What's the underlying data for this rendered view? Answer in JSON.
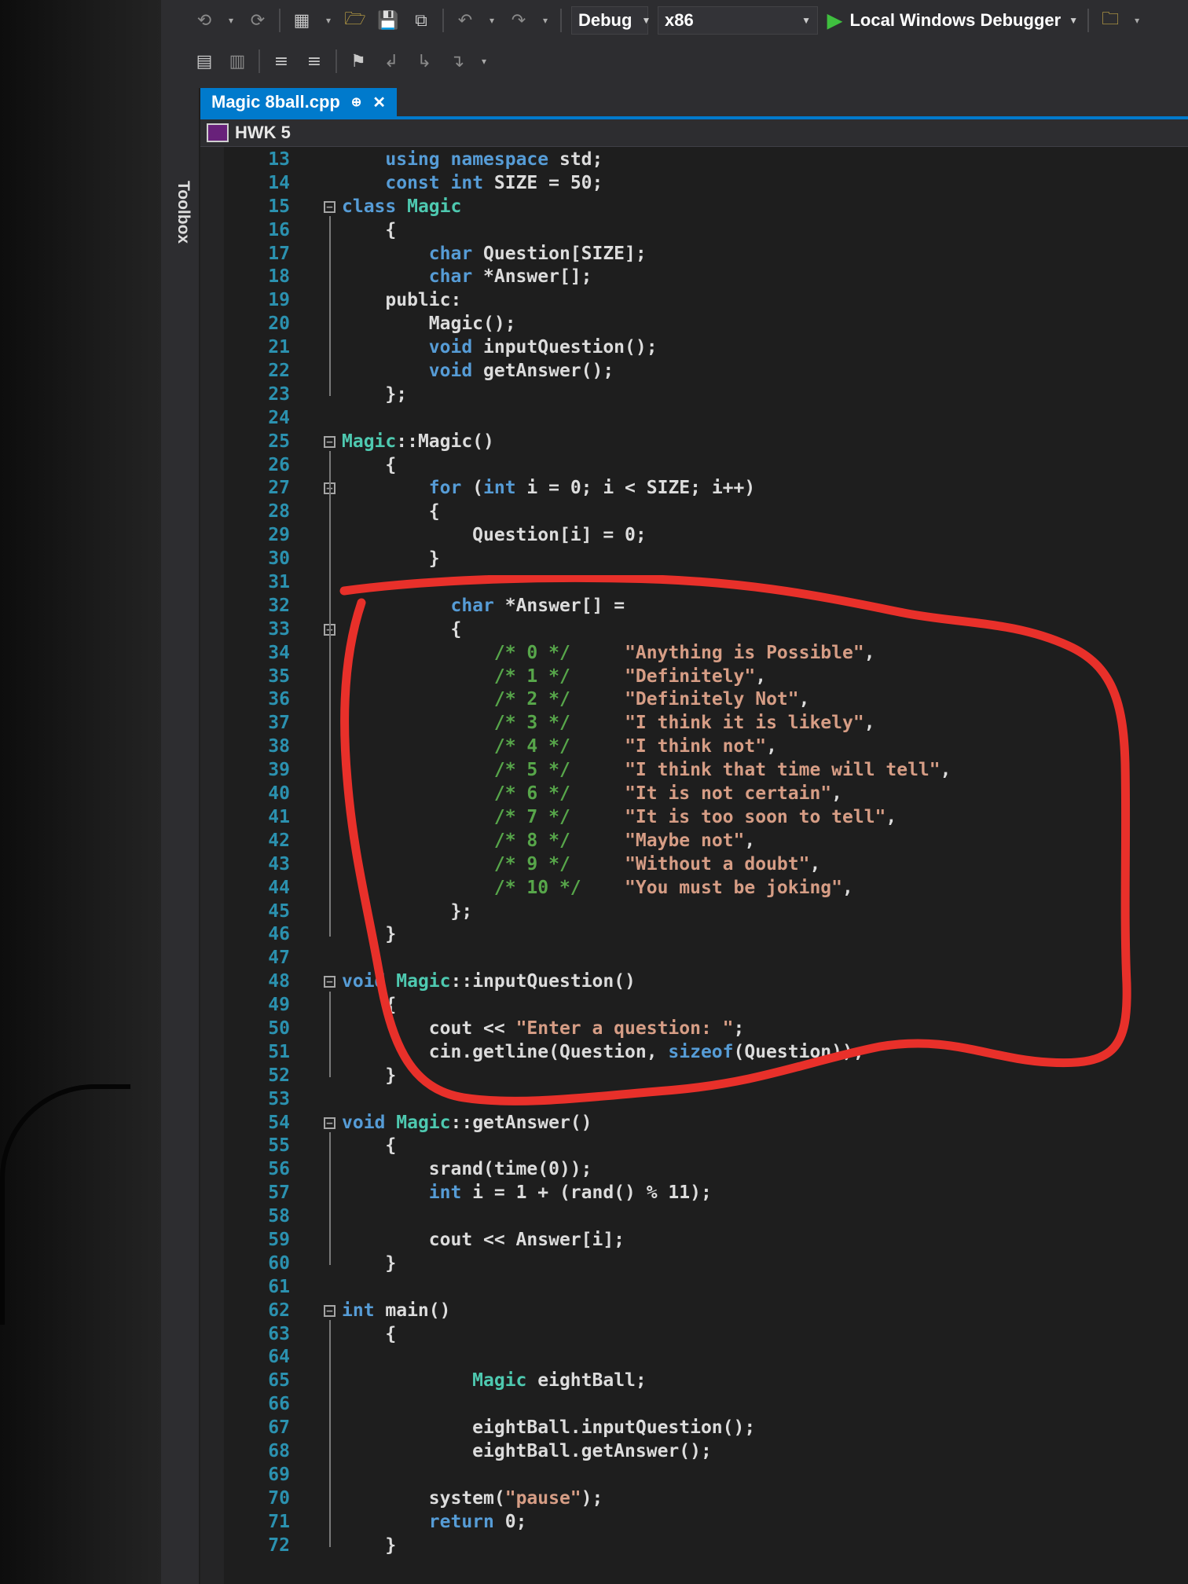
{
  "toolbar": {
    "config": "Debug",
    "platform": "x86",
    "debugger": "Local Windows Debugger",
    "icons_row1": [
      "back-icon",
      "forward-icon",
      "new-project-icon",
      "open-folder-icon",
      "save-icon",
      "save-all-icon",
      "undo-icon",
      "redo-icon"
    ],
    "icons_row2": [
      "comment-icon",
      "uncomment-icon",
      "indent-icon",
      "outdent-icon",
      "bookmark-icon",
      "prev-bookmark-icon",
      "next-bookmark-icon",
      "clear-bookmarks-icon"
    ]
  },
  "sidebar": {
    "toolbox_label": "Toolbox"
  },
  "tab": {
    "filename": "Magic 8ball.cpp",
    "pin": "⊕",
    "close": "✕"
  },
  "navbar": {
    "project": "HWK 5"
  },
  "annotation": {
    "color": "#e8302a"
  },
  "lines": [
    {
      "n": "13",
      "t": [
        [
          "    ",
          ""
        ],
        [
          "using",
          "kw"
        ],
        [
          " ",
          ""
        ],
        [
          "namespace",
          "kw"
        ],
        [
          " std;",
          ""
        ]
      ]
    },
    {
      "n": "14",
      "t": [
        [
          "    ",
          ""
        ],
        [
          "const",
          "kw"
        ],
        [
          " ",
          ""
        ],
        [
          "int",
          "kw"
        ],
        [
          " SIZE = 50;",
          ""
        ]
      ]
    },
    {
      "n": "15",
      "fold": true,
      "t": [
        [
          "class",
          "kw"
        ],
        [
          " ",
          ""
        ],
        [
          "Magic",
          "ty"
        ]
      ]
    },
    {
      "n": "16",
      "t": [
        [
          "    {",
          ""
        ]
      ]
    },
    {
      "n": "17",
      "t": [
        [
          "        ",
          ""
        ],
        [
          "char",
          "kw"
        ],
        [
          " Question[SIZE];",
          ""
        ]
      ]
    },
    {
      "n": "18",
      "t": [
        [
          "        ",
          ""
        ],
        [
          "char",
          "kw"
        ],
        [
          " *Answer[];",
          ""
        ]
      ]
    },
    {
      "n": "19",
      "t": [
        [
          "    public:",
          ""
        ]
      ]
    },
    {
      "n": "20",
      "t": [
        [
          "        Magic();",
          ""
        ]
      ]
    },
    {
      "n": "21",
      "t": [
        [
          "        ",
          ""
        ],
        [
          "void",
          "kw"
        ],
        [
          " inputQuestion();",
          ""
        ]
      ]
    },
    {
      "n": "22",
      "t": [
        [
          "        ",
          ""
        ],
        [
          "void",
          "kw"
        ],
        [
          " getAnswer();",
          ""
        ]
      ]
    },
    {
      "n": "23",
      "t": [
        [
          "    };",
          ""
        ]
      ]
    },
    {
      "n": "24",
      "t": []
    },
    {
      "n": "25",
      "fold": true,
      "t": [
        [
          "Magic",
          "ty"
        ],
        [
          "::Magic()",
          ""
        ]
      ]
    },
    {
      "n": "26",
      "t": [
        [
          "    {",
          ""
        ]
      ]
    },
    {
      "n": "27",
      "fold": true,
      "t": [
        [
          "        ",
          ""
        ],
        [
          "for",
          "kw"
        ],
        [
          " (",
          ""
        ],
        [
          "int",
          "kw"
        ],
        [
          " i = 0; i < SIZE; i++)",
          ""
        ]
      ]
    },
    {
      "n": "28",
      "t": [
        [
          "        {",
          ""
        ]
      ]
    },
    {
      "n": "29",
      "t": [
        [
          "            Question[i] = 0;",
          ""
        ]
      ]
    },
    {
      "n": "30",
      "t": [
        [
          "        }",
          ""
        ]
      ]
    },
    {
      "n": "31",
      "t": []
    },
    {
      "n": "32",
      "t": [
        [
          "          ",
          ""
        ],
        [
          "char",
          "kw"
        ],
        [
          " *Answer[] =",
          ""
        ]
      ]
    },
    {
      "n": "33",
      "fold": true,
      "t": [
        [
          "          {",
          ""
        ]
      ]
    },
    {
      "n": "34",
      "t": [
        [
          "              ",
          ""
        ],
        [
          "/* 0 */",
          "cmt"
        ],
        [
          "     ",
          ""
        ],
        [
          "\"Anything is Possible\"",
          "str"
        ],
        [
          ",",
          ""
        ]
      ]
    },
    {
      "n": "35",
      "t": [
        [
          "              ",
          ""
        ],
        [
          "/* 1 */",
          "cmt"
        ],
        [
          "     ",
          ""
        ],
        [
          "\"Definitely\"",
          "str"
        ],
        [
          ",",
          ""
        ]
      ]
    },
    {
      "n": "36",
      "t": [
        [
          "              ",
          ""
        ],
        [
          "/* 2 */",
          "cmt"
        ],
        [
          "     ",
          ""
        ],
        [
          "\"Definitely Not\"",
          "str"
        ],
        [
          ",",
          ""
        ]
      ]
    },
    {
      "n": "37",
      "t": [
        [
          "              ",
          ""
        ],
        [
          "/* 3 */",
          "cmt"
        ],
        [
          "     ",
          ""
        ],
        [
          "\"I think it is likely\"",
          "str"
        ],
        [
          ",",
          ""
        ]
      ]
    },
    {
      "n": "38",
      "t": [
        [
          "              ",
          ""
        ],
        [
          "/* 4 */",
          "cmt"
        ],
        [
          "     ",
          ""
        ],
        [
          "\"I think not\"",
          "str"
        ],
        [
          ",",
          ""
        ]
      ]
    },
    {
      "n": "39",
      "t": [
        [
          "              ",
          ""
        ],
        [
          "/* 5 */",
          "cmt"
        ],
        [
          "     ",
          ""
        ],
        [
          "\"I think that time will tell\"",
          "str"
        ],
        [
          ",",
          ""
        ]
      ]
    },
    {
      "n": "40",
      "t": [
        [
          "              ",
          ""
        ],
        [
          "/* 6 */",
          "cmt"
        ],
        [
          "     ",
          ""
        ],
        [
          "\"It is not certain\"",
          "str"
        ],
        [
          ",",
          ""
        ]
      ]
    },
    {
      "n": "41",
      "t": [
        [
          "              ",
          ""
        ],
        [
          "/* 7 */",
          "cmt"
        ],
        [
          "     ",
          ""
        ],
        [
          "\"It is too soon to tell\"",
          "str"
        ],
        [
          ",",
          ""
        ]
      ]
    },
    {
      "n": "42",
      "t": [
        [
          "              ",
          ""
        ],
        [
          "/* 8 */",
          "cmt"
        ],
        [
          "     ",
          ""
        ],
        [
          "\"Maybe not\"",
          "str"
        ],
        [
          ",",
          ""
        ]
      ]
    },
    {
      "n": "43",
      "t": [
        [
          "              ",
          ""
        ],
        [
          "/* 9 */",
          "cmt"
        ],
        [
          "     ",
          ""
        ],
        [
          "\"Without a doubt\"",
          "str"
        ],
        [
          ",",
          ""
        ]
      ]
    },
    {
      "n": "44",
      "t": [
        [
          "              ",
          ""
        ],
        [
          "/* 10 */",
          "cmt"
        ],
        [
          "    ",
          ""
        ],
        [
          "\"You must be joking\"",
          "str"
        ],
        [
          ",",
          ""
        ]
      ]
    },
    {
      "n": "45",
      "t": [
        [
          "          };",
          ""
        ]
      ]
    },
    {
      "n": "46",
      "t": [
        [
          "    }",
          ""
        ]
      ]
    },
    {
      "n": "47",
      "t": []
    },
    {
      "n": "48",
      "fold": true,
      "t": [
        [
          "void",
          "kw"
        ],
        [
          " ",
          ""
        ],
        [
          "Magic",
          "ty"
        ],
        [
          "::inputQuestion()",
          ""
        ]
      ]
    },
    {
      "n": "49",
      "t": [
        [
          "    {",
          ""
        ]
      ]
    },
    {
      "n": "50",
      "t": [
        [
          "        cout << ",
          ""
        ],
        [
          "\"Enter a question: \"",
          "str"
        ],
        [
          ";",
          ""
        ]
      ]
    },
    {
      "n": "51",
      "t": [
        [
          "        cin.getline(Question, ",
          ""
        ],
        [
          "sizeof",
          "kw"
        ],
        [
          "(Question));",
          ""
        ]
      ]
    },
    {
      "n": "52",
      "t": [
        [
          "    }",
          ""
        ]
      ]
    },
    {
      "n": "53",
      "t": []
    },
    {
      "n": "54",
      "fold": true,
      "t": [
        [
          "void",
          "kw"
        ],
        [
          " ",
          ""
        ],
        [
          "Magic",
          "ty"
        ],
        [
          "::getAnswer()",
          ""
        ]
      ]
    },
    {
      "n": "55",
      "t": [
        [
          "    {",
          ""
        ]
      ]
    },
    {
      "n": "56",
      "t": [
        [
          "        srand(time(0));",
          ""
        ]
      ]
    },
    {
      "n": "57",
      "t": [
        [
          "        ",
          ""
        ],
        [
          "int",
          "kw"
        ],
        [
          " i = 1 + (rand() % 11);",
          ""
        ]
      ]
    },
    {
      "n": "58",
      "t": []
    },
    {
      "n": "59",
      "t": [
        [
          "        cout << Answer[i];",
          ""
        ]
      ]
    },
    {
      "n": "60",
      "t": [
        [
          "    }",
          ""
        ]
      ]
    },
    {
      "n": "61",
      "t": []
    },
    {
      "n": "62",
      "fold": true,
      "t": [
        [
          "int",
          "kw"
        ],
        [
          " main()",
          ""
        ]
      ]
    },
    {
      "n": "63",
      "t": [
        [
          "    {",
          ""
        ]
      ]
    },
    {
      "n": "64",
      "t": []
    },
    {
      "n": "65",
      "t": [
        [
          "            ",
          ""
        ],
        [
          "Magic",
          "ty"
        ],
        [
          " eightBall;",
          ""
        ]
      ]
    },
    {
      "n": "66",
      "t": []
    },
    {
      "n": "67",
      "t": [
        [
          "            eightBall.inputQuestion();",
          ""
        ]
      ]
    },
    {
      "n": "68",
      "t": [
        [
          "            eightBall.getAnswer();",
          ""
        ]
      ]
    },
    {
      "n": "69",
      "t": []
    },
    {
      "n": "70",
      "t": [
        [
          "        system(",
          ""
        ],
        [
          "\"pause\"",
          "str"
        ],
        [
          ");",
          ""
        ]
      ]
    },
    {
      "n": "71",
      "t": [
        [
          "        ",
          ""
        ],
        [
          "return",
          "kw"
        ],
        [
          " 0;",
          ""
        ]
      ]
    },
    {
      "n": "72",
      "t": [
        [
          "    }",
          ""
        ]
      ]
    }
  ]
}
